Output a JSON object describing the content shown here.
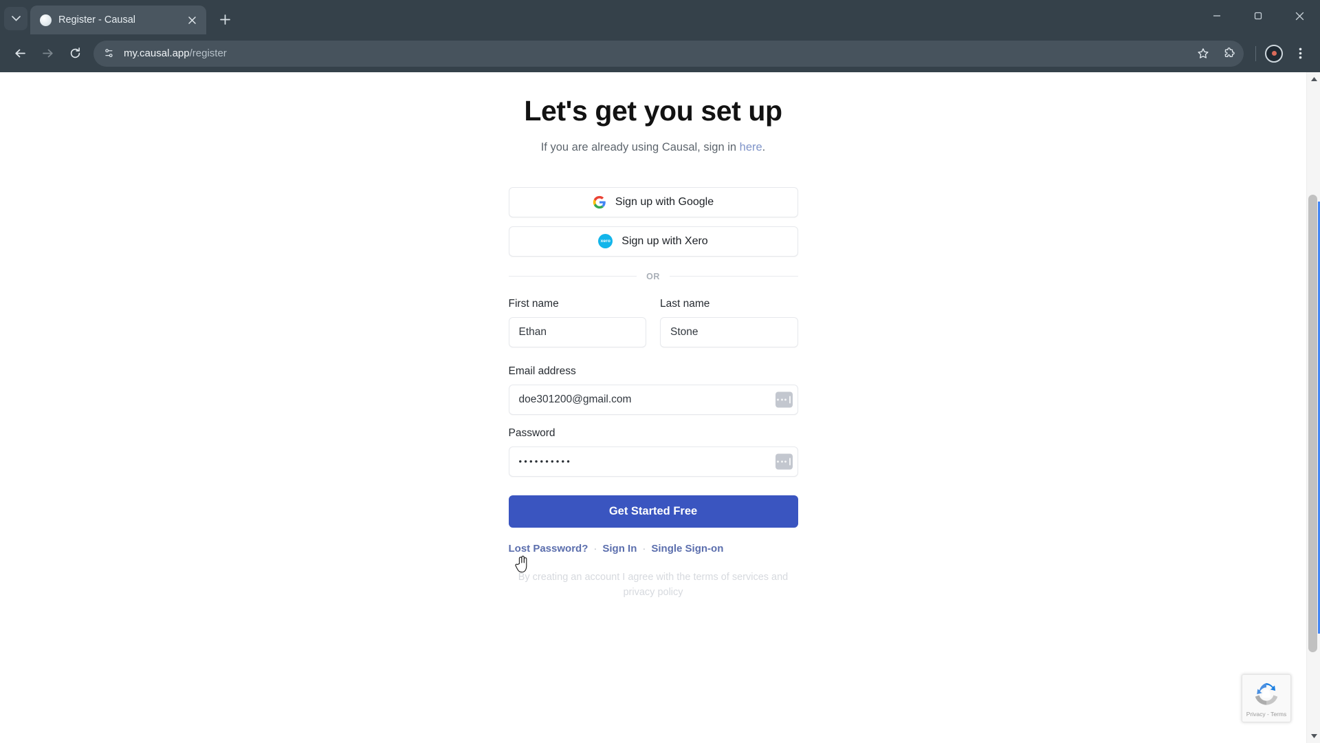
{
  "browser": {
    "tab": {
      "title": "Register - Causal",
      "favicon": "page-icon"
    },
    "new_tab_label": "+",
    "url_host": "my.causal.app",
    "url_path": "/register",
    "window_controls": {
      "minimize": "minimize",
      "maximize": "maximize",
      "close": "close"
    },
    "toolbar_icons": {
      "back": "back-arrow-icon",
      "forward": "forward-arrow-icon",
      "reload": "reload-icon",
      "site_info": "site-settings-icon",
      "bookmark": "star-icon",
      "extensions": "puzzle-piece-icon",
      "profile": "profile-avatar-icon",
      "menu": "three-dot-menu-icon"
    }
  },
  "page": {
    "title": "Let's get you set up",
    "subtitle_before": "If you are already using Causal, sign in ",
    "subtitle_link": "here",
    "subtitle_after": ".",
    "social": [
      {
        "id": "google",
        "label": "Sign up with Google",
        "icon": "google-logo-icon"
      },
      {
        "id": "xero",
        "label": "Sign up with Xero",
        "icon": "xero-logo-icon",
        "mark": "xero"
      }
    ],
    "divider_label": "OR",
    "fields": {
      "first_name": {
        "label": "First name",
        "value": "Ethan",
        "placeholder": "First name"
      },
      "last_name": {
        "label": "Last name",
        "value": "Stone",
        "placeholder": "Last name"
      },
      "email": {
        "label": "Email address",
        "value": "doe301200@gmail.com",
        "placeholder": "Email address"
      },
      "password": {
        "label": "Password",
        "value": "••••••••••",
        "placeholder": "Password"
      }
    },
    "submit_label": "Get Started Free",
    "links": [
      {
        "label": "Lost Password?"
      },
      {
        "label": "Sign In"
      },
      {
        "label": "Single Sign-on"
      }
    ],
    "link_separator": "·",
    "terms": "By creating an account I agree with the terms of services and privacy policy"
  },
  "recaptcha": {
    "text": "Privacy - Terms",
    "icon": "recaptcha-logo-icon"
  },
  "colors": {
    "chrome_bg": "#35414a",
    "tab_active": "#4a5660",
    "primary_button": "#3a55c0",
    "link": "#5b6ead",
    "subtitle_link": "#7f94c9",
    "xero_brand": "#13b5ea",
    "scroll_focus": "#4285f4"
  }
}
